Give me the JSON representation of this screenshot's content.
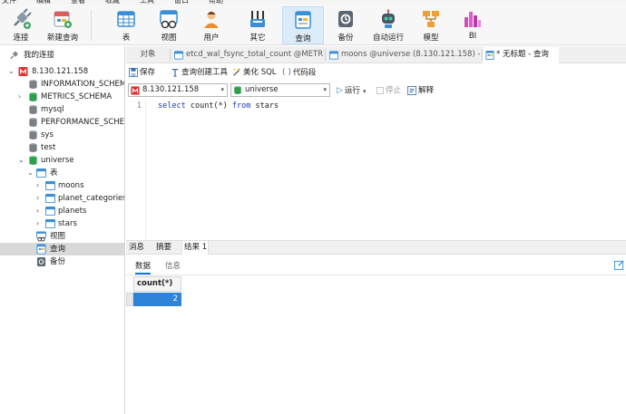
{
  "menu": {
    "items": [
      "文件",
      "编辑",
      "查看",
      "收藏",
      "工具",
      "窗口",
      "帮助"
    ]
  },
  "toolbar": {
    "connect": "连接",
    "new_query": "新建查询",
    "table": "表",
    "view": "视图",
    "user": "用户",
    "other": "其它",
    "query": "查询",
    "backup": "备份",
    "automation": "自动运行",
    "model": "模型",
    "bi": "BI"
  },
  "sidebar": {
    "root": "我的连接",
    "connection": "8.130.121.158",
    "dbs": [
      "INFORMATION_SCHEMA",
      "METRICS_SCHEMA",
      "mysql",
      "PERFORMANCE_SCHEMA",
      "sys",
      "test",
      "universe"
    ],
    "tables_label": "表",
    "tables": [
      "moons",
      "planet_categories",
      "planets",
      "stars"
    ],
    "views_label": "视图",
    "queries_label": "查询",
    "backups_label": "备份"
  },
  "tabs": {
    "objects": "对象",
    "t1": "etcd_wal_fsync_total_count @METRI...",
    "t2": "moons @universe (8.130.121.158) - 表",
    "t3": "* 无标题 - 查询"
  },
  "qbar": {
    "save": "保存",
    "builder": "查询创建工具",
    "beautify": "美化 SQL",
    "snippet": "代码段"
  },
  "cbar": {
    "connection": "8.130.121.158",
    "database": "universe",
    "run": "运行",
    "stop": "停止",
    "explain": "解释"
  },
  "editor": {
    "line": "1",
    "kw1": "select",
    "mid": " count(*) ",
    "kw2": "from",
    "tail": " stars"
  },
  "results": {
    "tabs": [
      "消息",
      "摘要",
      "结果 1"
    ],
    "sub_data": "数据",
    "sub_info": "信息",
    "column": "count(*)",
    "value": "2"
  }
}
